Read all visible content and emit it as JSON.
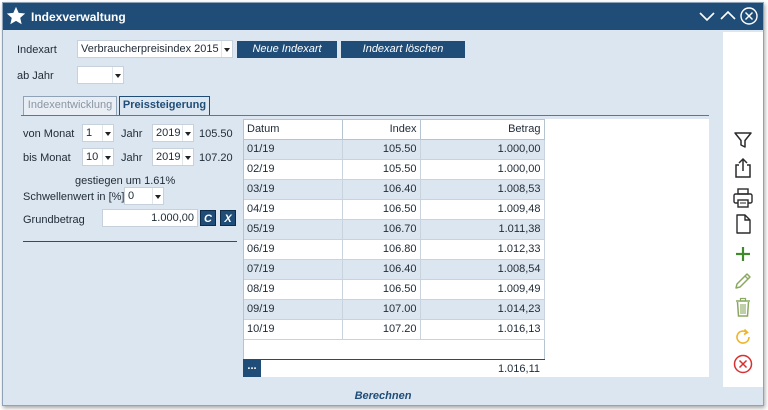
{
  "window": {
    "title": "Indexverwaltung"
  },
  "header": {
    "indexart_label": "Indexart",
    "indexart_value": "Verbraucherpreisindex 2015",
    "new_button": "Neue Indexart",
    "delete_button": "Indexart löschen",
    "abjahr_label": "ab Jahr",
    "abjahr_value": ""
  },
  "tabs": [
    {
      "label": "Indexentwicklung",
      "active": false
    },
    {
      "label": "Preissteigerung",
      "active": true
    }
  ],
  "form": {
    "von_monat_label": "von Monat",
    "von_monat_value": "1",
    "von_jahr_label": "Jahr",
    "von_jahr_value": "2019",
    "von_index": "105.50",
    "bis_monat_label": "bis Monat",
    "bis_monat_value": "10",
    "bis_jahr_label": "Jahr",
    "bis_jahr_value": "2019",
    "bis_index": "107.20",
    "gestiegen_text": "gestiegen um 1.61%",
    "schwellenwert_label": "Schwellenwert in [%]",
    "schwellenwert_value": "0",
    "grundbetrag_label": "Grundbetrag",
    "grundbetrag_value": "1.000,00",
    "c_button": "C",
    "x_button": "X"
  },
  "table": {
    "columns": [
      "Datum",
      "Index",
      "Betrag"
    ],
    "rows": [
      [
        "01/19",
        "105.50",
        "1.000,00"
      ],
      [
        "02/19",
        "105.50",
        "1.000,00"
      ],
      [
        "03/19",
        "106.40",
        "1.008,53"
      ],
      [
        "04/19",
        "106.50",
        "1.009,48"
      ],
      [
        "05/19",
        "106.70",
        "1.011,38"
      ],
      [
        "06/19",
        "106.80",
        "1.012,33"
      ],
      [
        "07/19",
        "106.40",
        "1.008,54"
      ],
      [
        "08/19",
        "106.50",
        "1.009,49"
      ],
      [
        "09/19",
        "107.00",
        "1.014,23"
      ],
      [
        "10/19",
        "107.20",
        "1.016,13"
      ]
    ],
    "footer_button": "...",
    "footer_total": "1.016,11"
  },
  "toolbar": {
    "icons": [
      "filter-icon",
      "share-icon",
      "print-icon",
      "new-document-icon",
      "plus-icon",
      "pencil-icon",
      "trash-icon",
      "refresh-icon",
      "cancel-icon"
    ]
  },
  "footer": {
    "berechnen": "Berechnen"
  },
  "colors": {
    "brand": "#1f4d78",
    "panel": "#dce6f0",
    "plus": "#3f8a2a",
    "pencil": "#8aa860",
    "trash": "#8aa860",
    "refresh": "#f0b428",
    "cancel": "#d83030"
  }
}
